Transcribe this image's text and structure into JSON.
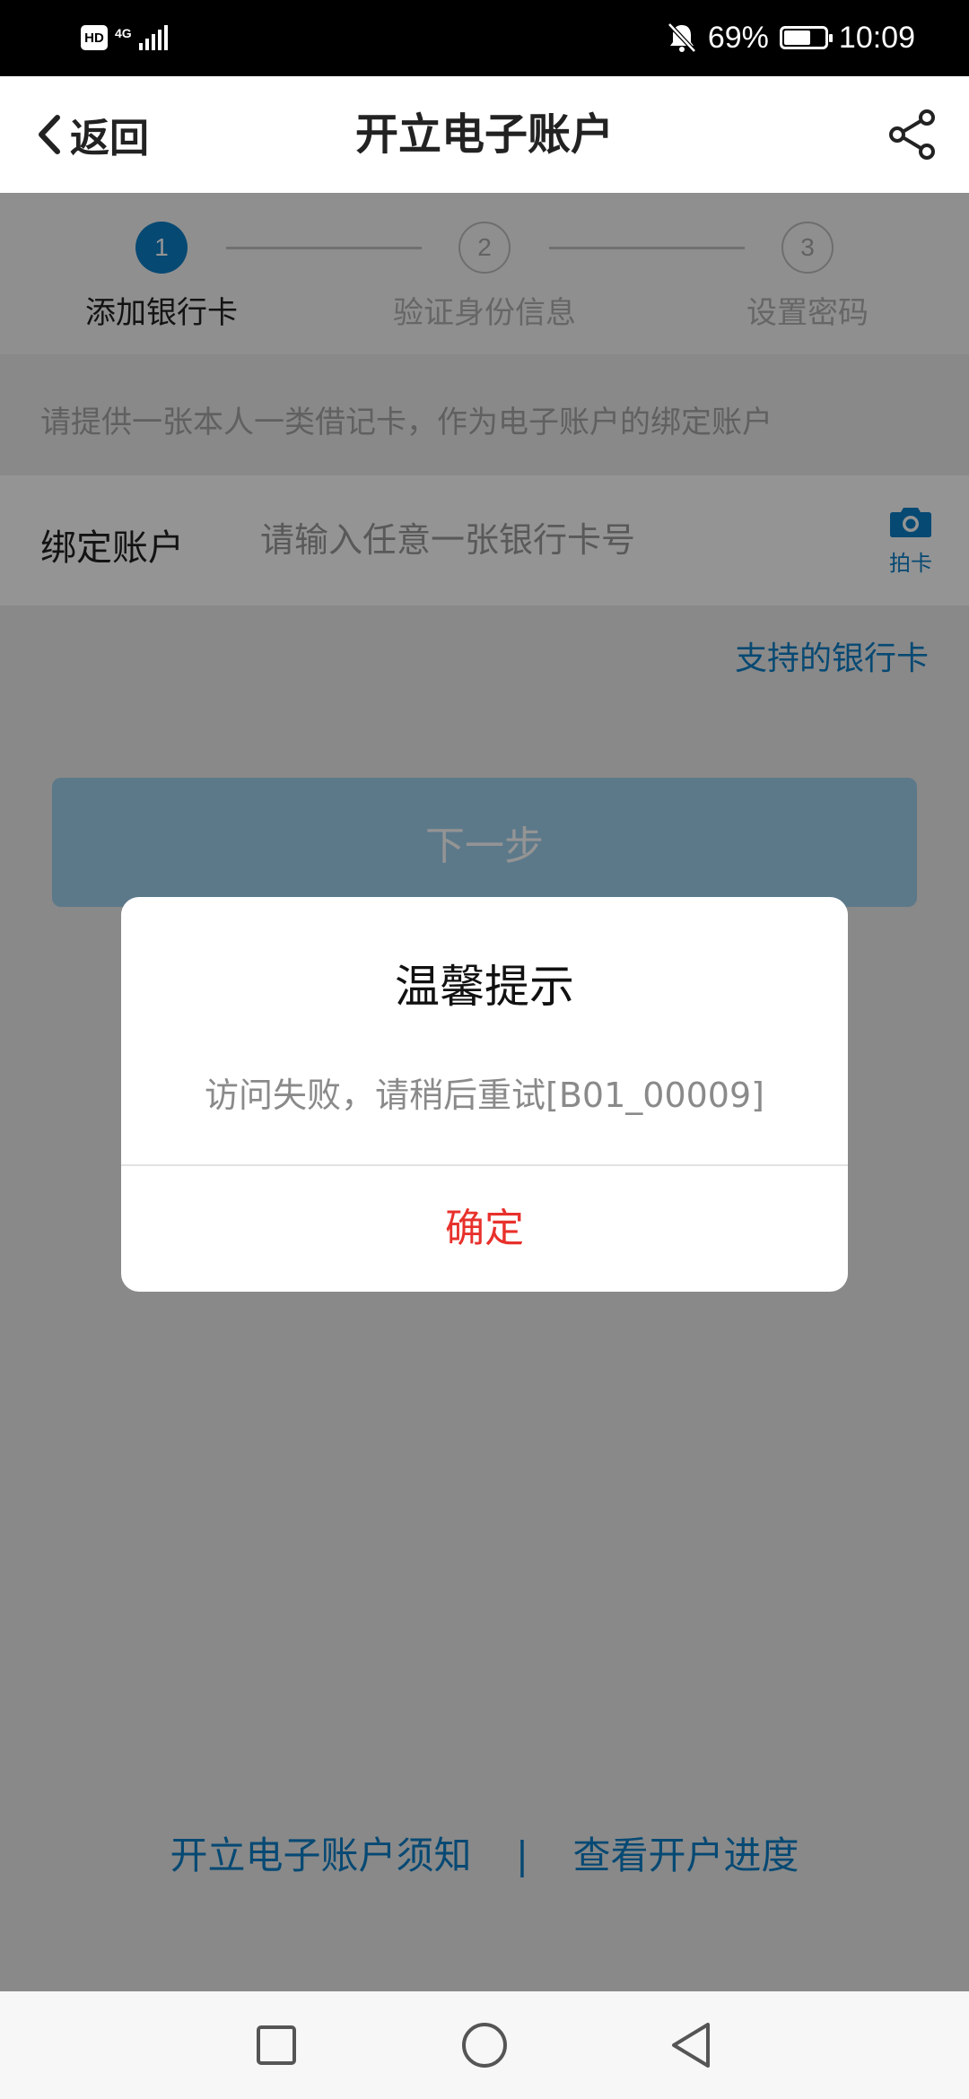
{
  "status_bar": {
    "network_badge": "HD",
    "network_type": "4G",
    "battery_percent": "69%",
    "battery_level": 0.69,
    "time": "10:09",
    "icons": [
      "hd-icon",
      "signal-icon",
      "mute-bell-icon",
      "battery-icon"
    ]
  },
  "header": {
    "back_label": "返回",
    "title": "开立电子账户",
    "share_icon": "share-icon"
  },
  "stepper": {
    "steps": [
      {
        "number": "1",
        "label": "添加银行卡",
        "active": true
      },
      {
        "number": "2",
        "label": "验证身份信息",
        "active": false
      },
      {
        "number": "3",
        "label": "设置密码",
        "active": false
      }
    ]
  },
  "hint": "请提供一张本人一类借记卡，作为电子账户的绑定账户",
  "bind_account": {
    "label": "绑定账户",
    "placeholder": "请输入任意一张银行卡号",
    "value": "",
    "camera_label": "拍卡"
  },
  "supported_banks_link": "支持的银行卡",
  "next_button": "下一步",
  "footer": {
    "notice_link": "开立电子账户须知",
    "separator": "|",
    "progress_link": "查看开户进度"
  },
  "dialog": {
    "title": "温馨提示",
    "message": "访问失败，请稍后重试[B01_00009]",
    "confirm": "确定"
  },
  "nav_bar": {
    "icons": [
      "recent-apps-icon",
      "home-icon",
      "back-nav-icon"
    ]
  },
  "colors": {
    "accent": "#0c7ec7",
    "confirm": "#e8312c",
    "status_bar_bg": "#000000"
  }
}
